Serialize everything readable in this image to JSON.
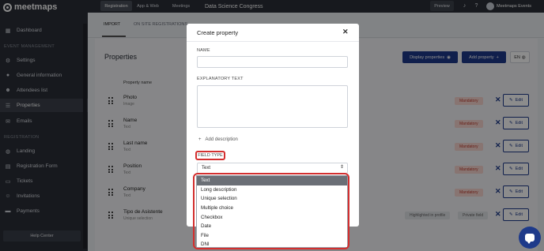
{
  "app": {
    "brand": "meetmaps"
  },
  "sidebar": {
    "items": [
      {
        "label": "Dashboard",
        "icon": "dashboard-icon"
      },
      {
        "label": "Settings",
        "icon": "gear-icon"
      },
      {
        "label": "General information",
        "icon": "info-icon"
      },
      {
        "label": "Attendees list",
        "icon": "users-icon"
      },
      {
        "label": "Properties",
        "icon": "list-icon"
      },
      {
        "label": "Emails",
        "icon": "mail-icon"
      },
      {
        "label": "Landing",
        "icon": "globe-icon"
      },
      {
        "label": "Registration Form",
        "icon": "form-icon"
      },
      {
        "label": "Tickets",
        "icon": "ticket-icon"
      },
      {
        "label": "Invitations",
        "icon": "invitation-icon"
      },
      {
        "label": "Payments",
        "icon": "payment-icon"
      }
    ],
    "sections": {
      "event_management": "EVENT MANAGEMENT",
      "registration": "REGISTRATION"
    },
    "help_center": "Help Center"
  },
  "topbar": {
    "tabs": [
      "Registration",
      "App & Web",
      "Meetings"
    ],
    "event_name": "Data Science Congress",
    "preview": "Preview",
    "account_name": "Meetmaps Events"
  },
  "subtabs": [
    "IMPORT",
    "ON SITE REGISTRATIONS"
  ],
  "panel": {
    "title": "Properties",
    "display_button": "Display properties",
    "add_button": "Add property",
    "language": "EN",
    "column_header": "Property name",
    "rows": [
      {
        "name": "Photo",
        "type": "Image",
        "badge": "Mandatory",
        "badge_kind": "mandatory"
      },
      {
        "name": "Name",
        "type": "Text",
        "badge": "Mandatory",
        "badge_kind": "mandatory"
      },
      {
        "name": "Last name",
        "type": "Text",
        "badge": "Mandatory",
        "badge_kind": "mandatory"
      },
      {
        "name": "Position",
        "type": "Text",
        "badge": "Mandatory",
        "badge_kind": "mandatory"
      },
      {
        "name": "Company",
        "type": "Text",
        "badge": "Mandatory",
        "badge_kind": "mandatory"
      },
      {
        "name": "Tipo de Asistente",
        "type": "Unique selection",
        "badge": "Private field",
        "badge_kind": "grey",
        "badge2": "Highlighted in profile"
      }
    ],
    "edit_label": "Edit"
  },
  "modal": {
    "title": "Create property",
    "name_label": "NAME",
    "name_value": "",
    "explanatory_label": "EXPLANATORY TEXT",
    "explanatory_value": "",
    "add_description": "Add description",
    "field_type_label": "FIELD TYPE",
    "field_type_value": "Text",
    "options": [
      "Text",
      "Long description",
      "Unique selection",
      "Multiple choice",
      "Checkbox",
      "Date",
      "File",
      "DNI"
    ],
    "selected_option": "Text"
  },
  "colors": {
    "primary": "#1e3a8a",
    "sidebar": "#2b2f38",
    "highlight": "#d32f2f",
    "mandatory": "#c0392b"
  }
}
